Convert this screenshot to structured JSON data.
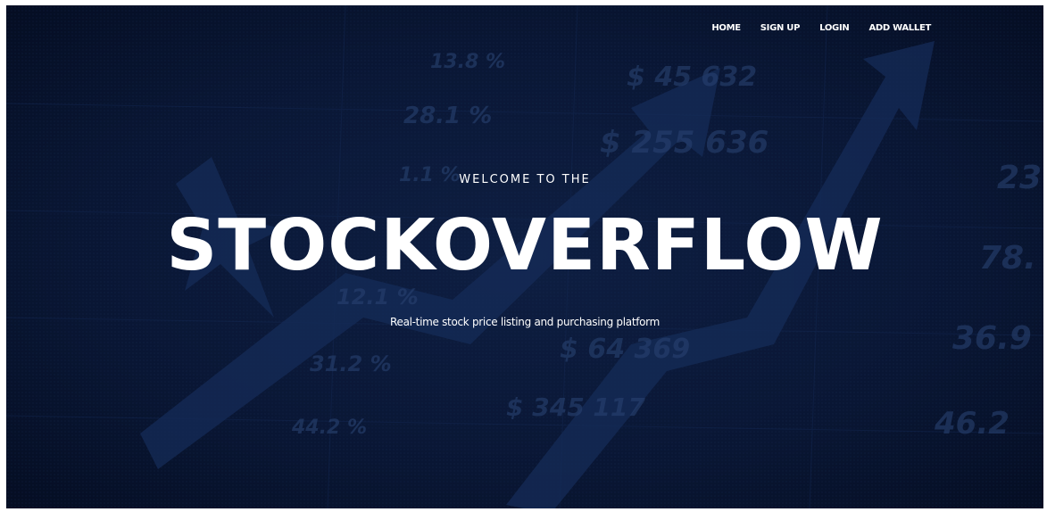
{
  "nav": {
    "items": [
      {
        "label": "HOME"
      },
      {
        "label": "SIGN UP"
      },
      {
        "label": "LOGIN"
      },
      {
        "label": "ADD WALLET"
      }
    ]
  },
  "hero": {
    "welcome": "WELCOME TO THE",
    "title": "STOCKOVERFLOW",
    "subtitle": "Real-time stock price listing and purchasing platform"
  },
  "background": {
    "numbers": [
      "28.1 %",
      "$ 45 632",
      "$ 255 636",
      "1.1 %",
      "12.1 %",
      "31.2 %",
      "$ 64 369",
      "23",
      "78.",
      "36.9",
      "46.2",
      "$ 345 117",
      "13.8 %",
      "44.2 %"
    ]
  },
  "colors": {
    "background": "#0a1530",
    "text": "#ffffff"
  }
}
